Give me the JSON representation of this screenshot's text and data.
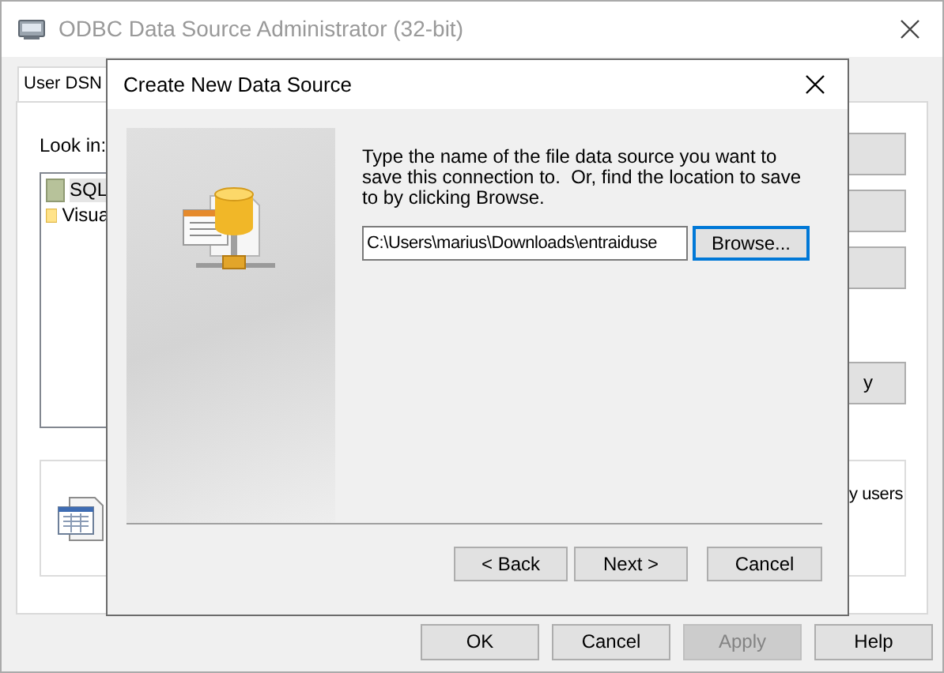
{
  "window": {
    "title": "ODBC Data Source Administrator (32-bit)"
  },
  "tabs": [
    {
      "label": "User DSN",
      "selected": true
    }
  ],
  "look_in": {
    "label": "Look in:",
    "items": [
      {
        "label": "SQL",
        "selected": true
      },
      {
        "label": "Visua",
        "selected": false
      }
    ]
  },
  "side_buttons": [
    {
      "kind": "blank"
    },
    {
      "kind": "blank"
    },
    {
      "kind": "blank"
    },
    {
      "kind": "labeled",
      "label": "y"
    }
  ],
  "info": {
    "text": "y users"
  },
  "buttons": [
    {
      "label": "OK",
      "disabled": false
    },
    {
      "label": "Cancel",
      "disabled": false
    },
    {
      "label": "Apply",
      "disabled": true
    },
    {
      "label": "Help",
      "disabled": false
    }
  ],
  "dialog": {
    "title": "Create New Data Source",
    "instructions": "Type the name of the file data source you want to save this connection to.  Or, find the location to save to by clicking Browse.",
    "path_value": "C:\\Users\\marius\\Downloads\\entraiduse",
    "browse": {
      "label": "Browse...",
      "focused": true
    },
    "buttons": [
      {
        "label": "< Back"
      },
      {
        "label": "Next >"
      },
      {
        "label": "Cancel"
      }
    ]
  }
}
